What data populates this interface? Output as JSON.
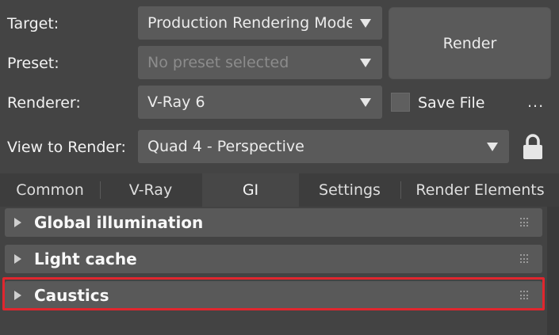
{
  "form": {
    "target_label": "Target:",
    "target_value": "Production Rendering Mode",
    "preset_label": "Preset:",
    "preset_value": "No preset selected",
    "renderer_label": "Renderer:",
    "renderer_value": "V-Ray 6",
    "view_label": "View to Render:",
    "view_value": "Quad 4 - Perspective"
  },
  "render_button": "Render",
  "save_file": {
    "label": "Save File",
    "checked": false
  },
  "more_button": "...",
  "tabs": [
    {
      "label": "Common",
      "active": false
    },
    {
      "label": "V-Ray",
      "active": false
    },
    {
      "label": "GI",
      "active": true
    },
    {
      "label": "Settings",
      "active": false
    },
    {
      "label": "Render Elements",
      "active": false
    }
  ],
  "rollouts": [
    {
      "label": "Global illumination",
      "expanded": false
    },
    {
      "label": "Light cache",
      "expanded": false
    },
    {
      "label": "Caustics",
      "expanded": false,
      "highlighted": true
    }
  ],
  "colors": {
    "background": "#444444",
    "control": "#5a5a5a",
    "highlight": "#e0262e"
  }
}
